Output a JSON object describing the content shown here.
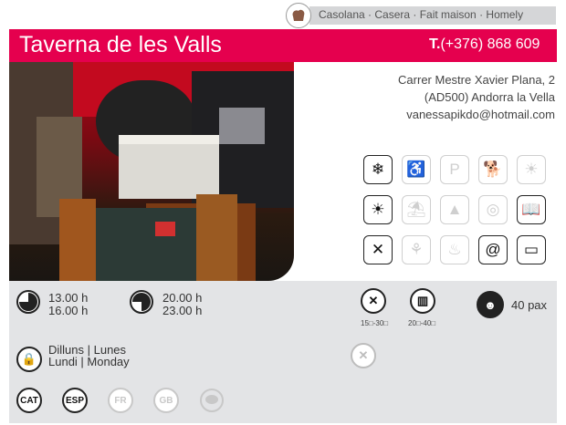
{
  "header": {
    "cuisine": "Casolana · Casera · Fait maison · Homely",
    "title": "Taverna de les Valls",
    "phone_prefix": "T.",
    "phone": "(+376) 868 609"
  },
  "address": {
    "line1": "Carrer Mestre Xavier Plana, 2",
    "line2": "(AD500) Andorra la Vella",
    "email": "vanessapikdo@hotmail.com"
  },
  "amenity_icons": [
    {
      "name": "air-conditioning-icon",
      "glyph": "❄",
      "state": "on"
    },
    {
      "name": "wheelchair-access-icon",
      "glyph": "♿",
      "state": "off"
    },
    {
      "name": "parking-icon",
      "glyph": "P",
      "state": "off"
    },
    {
      "name": "pets-allowed-icon",
      "glyph": "🐕",
      "state": "off"
    },
    {
      "name": "terrace-sun-icon",
      "glyph": "☀",
      "state": "off"
    },
    {
      "name": "terrace-shade-icon",
      "glyph": "☀",
      "state": "on"
    },
    {
      "name": "sun-deck-icon",
      "glyph": "⛱",
      "state": "off"
    },
    {
      "name": "mountain-view-icon",
      "glyph": "▲",
      "state": "off"
    },
    {
      "name": "outdoor-area-icon",
      "glyph": "◎",
      "state": "off"
    },
    {
      "name": "menu-book-icon",
      "glyph": "📖",
      "state": "on"
    },
    {
      "name": "cutlery-icon",
      "glyph": "✕",
      "state": "on"
    },
    {
      "name": "gluten-free-icon",
      "glyph": "⚘",
      "state": "off"
    },
    {
      "name": "chef-takeaway-icon",
      "glyph": "♨",
      "state": "off"
    },
    {
      "name": "email-at-icon",
      "glyph": "@",
      "state": "on"
    },
    {
      "name": "credit-card-icon",
      "glyph": "▭",
      "state": "on"
    }
  ],
  "schedule": {
    "lunch_open": "13.00 h",
    "lunch_close": "16.00 h",
    "dinner_open": "20.00 h",
    "dinner_close": "23.00 h"
  },
  "prices": {
    "daily_menu": "15□-30□",
    "carte": "20□-40□"
  },
  "capacity": "40 pax",
  "closed": {
    "line1": "Dilluns | Lunes",
    "line2": "Lundi | Monday"
  },
  "languages": [
    {
      "code": "CAT",
      "state": "on"
    },
    {
      "code": "ESP",
      "state": "on"
    },
    {
      "code": "FR",
      "state": "off"
    },
    {
      "code": "GB",
      "state": "off"
    }
  ],
  "colors": {
    "accent": "#e5004e",
    "panel": "#e3e4e6"
  }
}
